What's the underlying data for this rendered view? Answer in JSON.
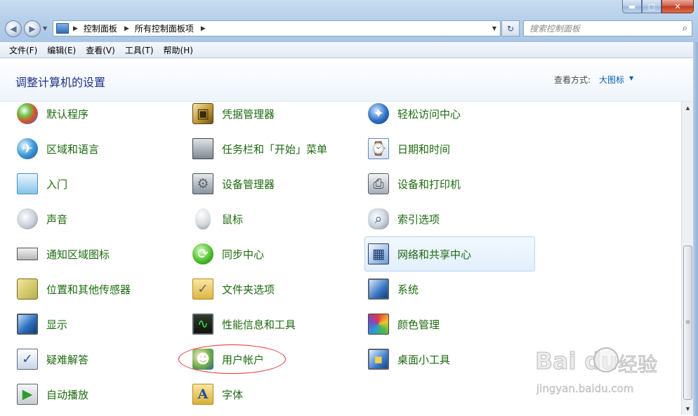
{
  "window": {
    "buttons": {
      "minimize": "▬",
      "maximize": "□",
      "close": "✕"
    }
  },
  "navigation": {
    "back_icon": "back-arrow-icon",
    "forward_icon": "forward-arrow-icon",
    "breadcrumb": [
      "控制面板",
      "所有控制面板项"
    ],
    "search_placeholder": "搜索控制面板"
  },
  "menubar": {
    "items": [
      "文件(F)",
      "编辑(E)",
      "查看(V)",
      "工具(T)",
      "帮助(H)"
    ]
  },
  "header": {
    "title": "调整计算机的设置",
    "view_label": "查看方式:",
    "view_value": "大图标"
  },
  "items": {
    "col1": [
      "默认程序",
      "区域和语言",
      "入门",
      "声音",
      "通知区域图标",
      "位置和其他传感器",
      "显示",
      "疑难解答",
      "自动播放"
    ],
    "col2": [
      "凭据管理器",
      "任务栏和「开始」菜单",
      "设备管理器",
      "鼠标",
      "同步中心",
      "文件夹选项",
      "性能信息和工具",
      "用户帐户",
      "字体"
    ],
    "col3": [
      "轻松访问中心",
      "日期和时间",
      "设备和打印机",
      "索引选项",
      "网络和共享中心",
      "系统",
      "颜色管理",
      "桌面小工具"
    ]
  },
  "highlighted_item": "网络和共享中心",
  "annotated_item": "用户帐户",
  "icon_glyphs": {
    "globe": "✈",
    "safe": "▣",
    "sync": "⟳",
    "folder": "✓",
    "perf": "∿",
    "users": "☻",
    "fonts": "A",
    "access": "✦",
    "calendar": "⌚",
    "printer": "⎙",
    "index": "⌕",
    "network": "▦",
    "gadgets": "▪",
    "trouble": "✓",
    "autoplay": "▶",
    "devmgr": "⚙"
  },
  "watermark": {
    "brand": "Bai  du",
    "cn": "经验",
    "url": "jingyan.baidu.com"
  },
  "colors": {
    "item_label": "#1d6a0f",
    "title": "#1e3287",
    "link": "#0d5ea8",
    "annotation": "#d9312d"
  }
}
